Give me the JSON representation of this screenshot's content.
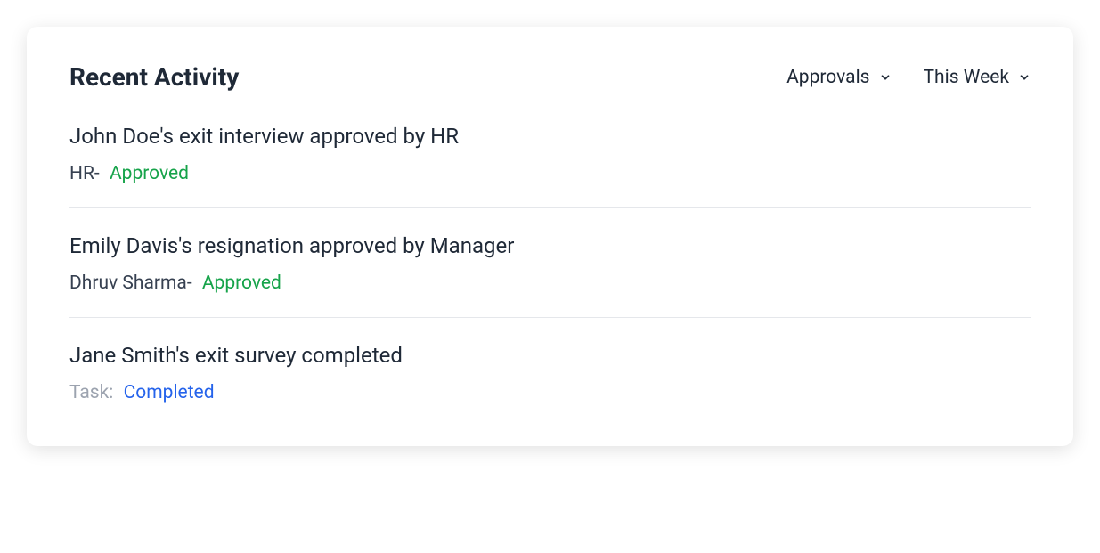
{
  "header": {
    "title": "Recent Activity",
    "filters": {
      "type": "Approvals",
      "range": "This Week"
    }
  },
  "activities": [
    {
      "title": "John Doe's exit interview approved by HR",
      "meta_prefix": "HR-",
      "status": "Approved",
      "status_class": "status-approved",
      "muted": false
    },
    {
      "title": "Emily Davis's resignation approved by Manager",
      "meta_prefix": "Dhruv Sharma-",
      "status": "Approved",
      "status_class": "status-approved",
      "muted": false
    },
    {
      "title": "Jane Smith's exit survey completed",
      "meta_prefix": "Task:",
      "status": "Completed",
      "status_class": "status-completed",
      "muted": true
    }
  ]
}
